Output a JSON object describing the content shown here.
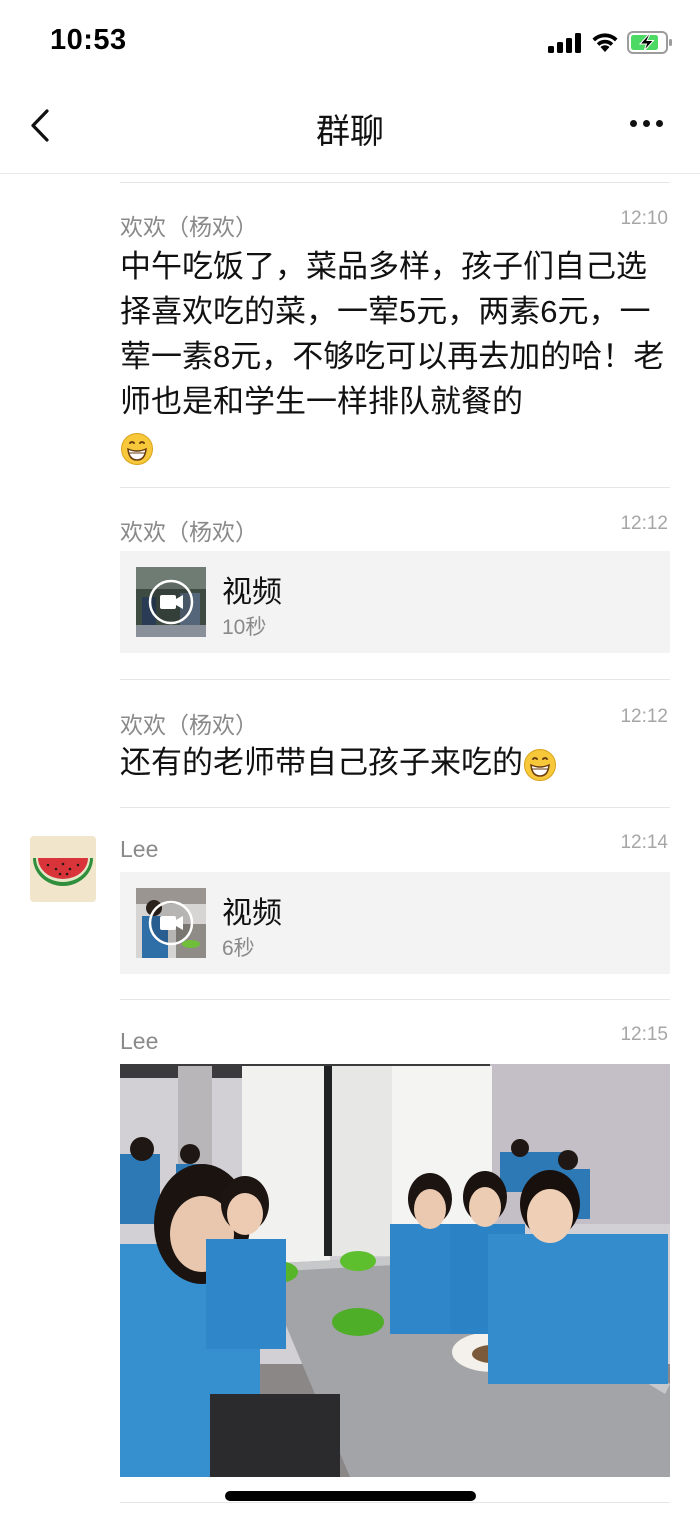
{
  "status_bar": {
    "time": "10:53"
  },
  "nav": {
    "title": "群聊"
  },
  "messages": [
    {
      "sender": "欢欢（杨欢）",
      "time": "12:10",
      "text": "中午吃饭了，菜品多样，孩子们自己选择喜欢吃的菜，一荤5元，两素6元，一荤一素8元，不够吃可以再去加的哈！老师也是和学生一样排队就餐的",
      "emoji": "grinning-face"
    },
    {
      "sender": "欢欢（杨欢）",
      "time": "12:12",
      "video_title": "视频",
      "video_duration": "10秒"
    },
    {
      "sender": "欢欢（杨欢）",
      "time": "12:12",
      "text": "还有的老师带自己孩子来吃的",
      "emoji": "grinning-face"
    },
    {
      "sender": "Lee",
      "time": "12:14",
      "video_title": "视频",
      "video_duration": "6秒",
      "avatar": "watermelon"
    },
    {
      "sender": "Lee",
      "time": "12:15",
      "image": "photo of students in blue jackets eating at a canteen table"
    }
  ],
  "icons": {
    "back": "chevron-left-icon",
    "more": "more-horizontal-icon",
    "video": "video-camera-icon"
  },
  "colors": {
    "background": "#ffffff",
    "card": "#f3f3f3",
    "secondary_text": "#8a8a8a",
    "battery_fill": "#4cd964"
  }
}
